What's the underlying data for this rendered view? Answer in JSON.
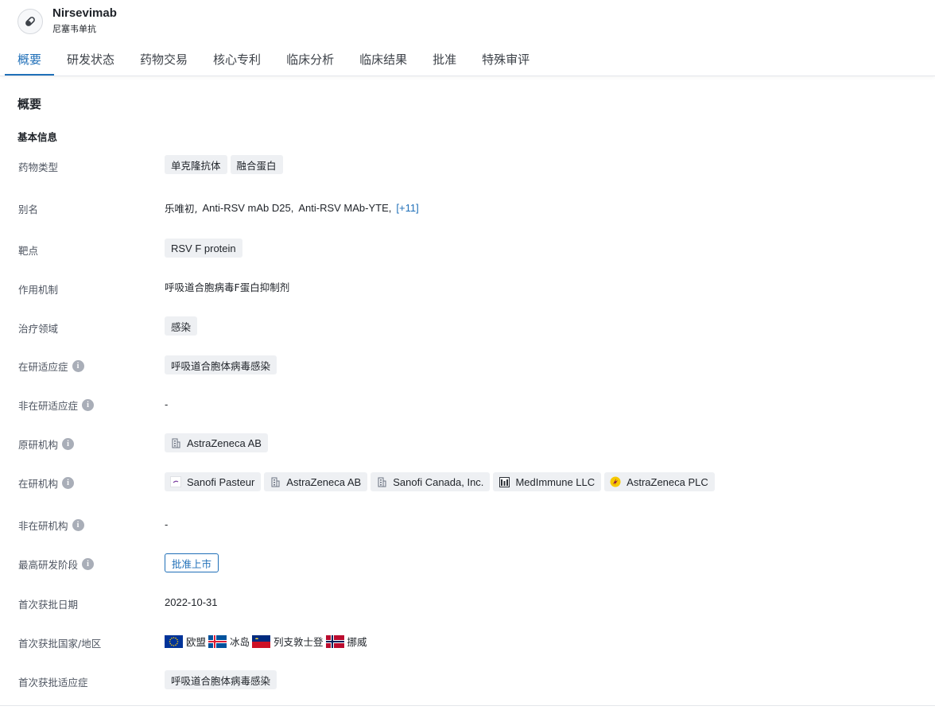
{
  "header": {
    "drug_name": "Nirsevimab",
    "drug_name_cn": "尼塞韦单抗",
    "logo_icon": "pill-icon"
  },
  "tabs": [
    {
      "label": "概要",
      "active": true
    },
    {
      "label": "研发状态",
      "active": false
    },
    {
      "label": "药物交易",
      "active": false
    },
    {
      "label": "核心专利",
      "active": false
    },
    {
      "label": "临床分析",
      "active": false
    },
    {
      "label": "临床结果",
      "active": false
    },
    {
      "label": "批准",
      "active": false
    },
    {
      "label": "特殊审评",
      "active": false
    }
  ],
  "section": {
    "title": "概要",
    "subtitle": "基本信息"
  },
  "fields": {
    "drug_type": {
      "label": "药物类型",
      "tags": [
        "单克隆抗体",
        "融合蛋白"
      ]
    },
    "alias": {
      "label": "别名",
      "values": [
        "乐唯初,",
        "Anti-RSV mAb D25,",
        "Anti-RSV MAb-YTE,"
      ],
      "more": "[+11]"
    },
    "target": {
      "label": "靶点",
      "tags": [
        "RSV F protein"
      ]
    },
    "mechanism": {
      "label": "作用机制",
      "value": "呼吸道合胞病毒F蛋白抑制剂"
    },
    "therapeutic_area": {
      "label": "治疗领域",
      "tags": [
        "感染"
      ]
    },
    "active_indication": {
      "label": "在研适应症",
      "tags": [
        "呼吸道合胞体病毒感染"
      ]
    },
    "inactive_indication": {
      "label": "非在研适应症",
      "value": "-"
    },
    "originator": {
      "label": "原研机构",
      "orgs": [
        {
          "name": "AstraZeneca AB",
          "icon": "building-icon"
        }
      ]
    },
    "active_org": {
      "label": "在研机构",
      "orgs": [
        {
          "name": "Sanofi Pasteur",
          "icon": "sanofi-logo-icon"
        },
        {
          "name": "AstraZeneca AB",
          "icon": "building-icon"
        },
        {
          "name": "Sanofi Canada, Inc.",
          "icon": "building-icon"
        },
        {
          "name": "MedImmune LLC",
          "icon": "medimmune-logo-icon"
        },
        {
          "name": "AstraZeneca PLC",
          "icon": "astrazeneca-logo-icon"
        }
      ]
    },
    "inactive_org": {
      "label": "非在研机构",
      "value": "-"
    },
    "highest_phase": {
      "label": "最高研发阶段",
      "value": "批准上市"
    },
    "first_approval_date": {
      "label": "首次获批日期",
      "value": "2022-10-31"
    },
    "first_approval_region": {
      "label": "首次获批国家/地区",
      "countries": [
        {
          "name": "欧盟",
          "flag": "eu-flag-icon"
        },
        {
          "name": "冰岛",
          "flag": "iceland-flag-icon"
        },
        {
          "name": "列支敦士登",
          "flag": "liechtenstein-flag-icon"
        },
        {
          "name": "挪威",
          "flag": "norway-flag-icon"
        }
      ]
    },
    "first_approval_indication": {
      "label": "首次获批适应症",
      "tags": [
        "呼吸道合胞体病毒感染"
      ]
    }
  },
  "colors": {
    "accent": "#1f6fb8",
    "tag_bg": "#eef0f3",
    "label_text": "#4e5561"
  }
}
